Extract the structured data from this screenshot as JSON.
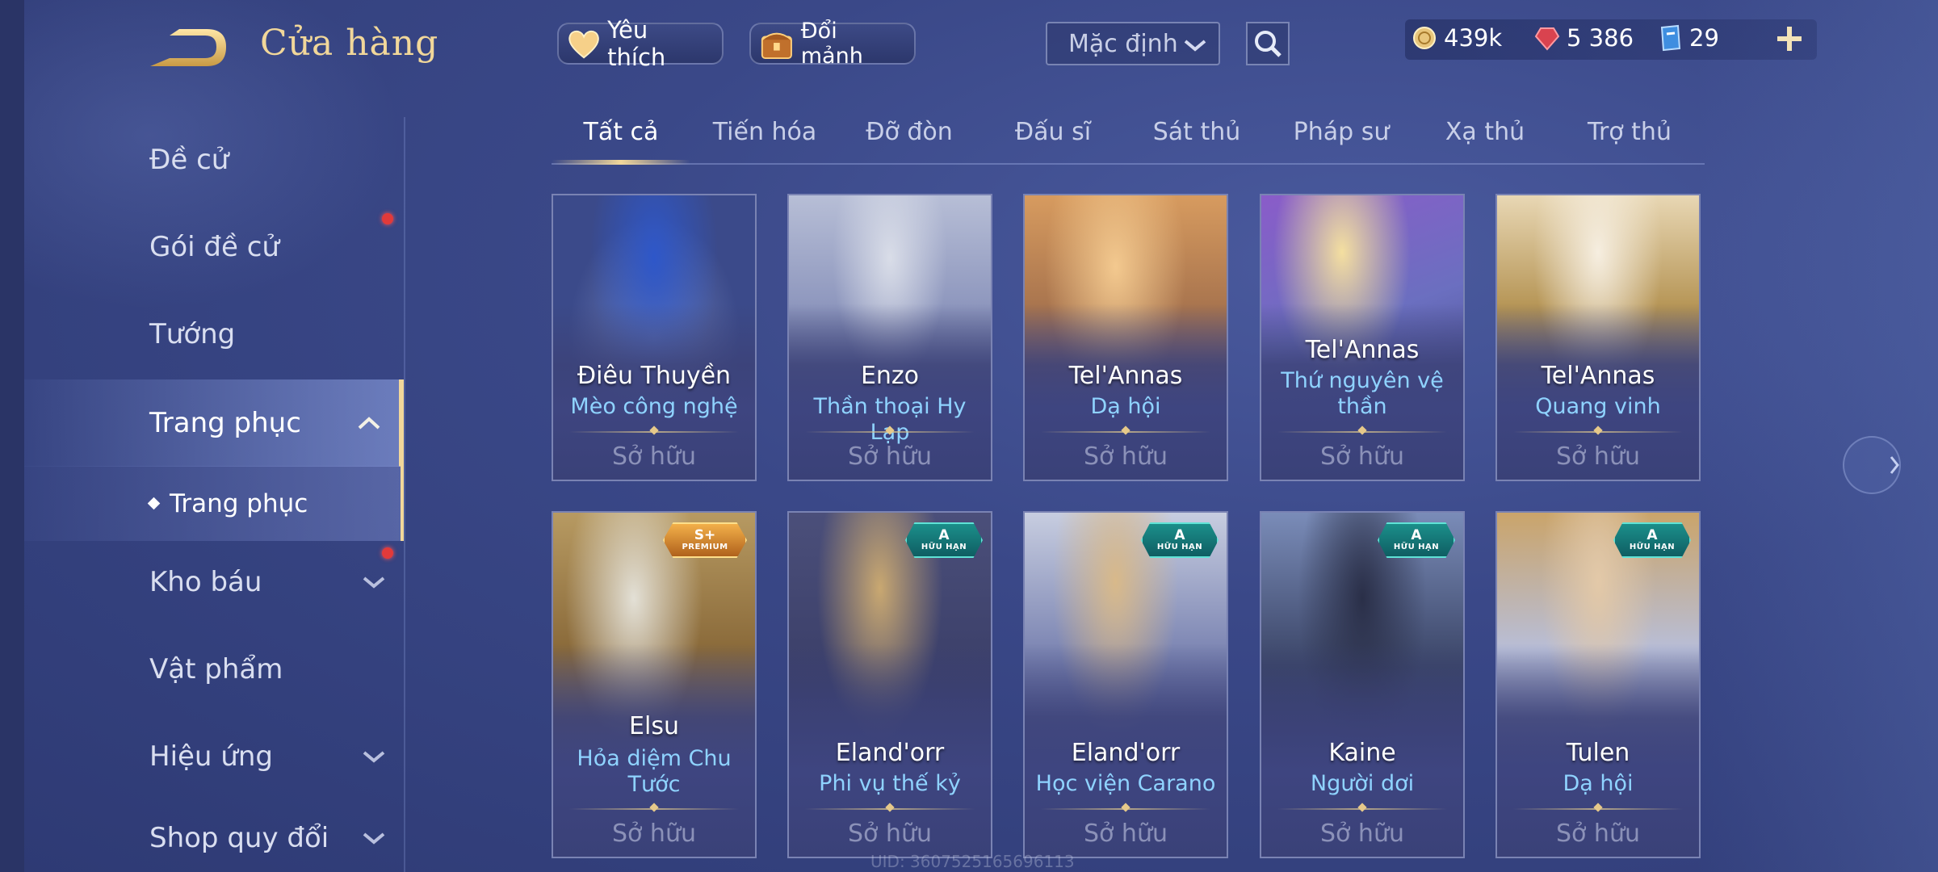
{
  "header": {
    "title": "Cửa hàng",
    "back_icon": "back-arrow-icon"
  },
  "sidebar": {
    "items": [
      {
        "label": "Đề cử"
      },
      {
        "label": "Gói đề cử",
        "notification": true
      },
      {
        "label": "Tướng"
      },
      {
        "label": "Trang phục",
        "expanded": true,
        "active": true
      },
      {
        "label": "Kho báu",
        "notification": true
      },
      {
        "label": "Vật phẩm"
      },
      {
        "label": "Hiệu ứng"
      },
      {
        "label": "Shop quy đổi"
      }
    ],
    "sub_item": {
      "label": "Trang phục",
      "active": true
    }
  },
  "topbar": {
    "favorite_label": "Yêu thích",
    "exchange_label": "Đổi mảnh",
    "sort_value": "Mặc định",
    "currencies": [
      {
        "icon": "gold-coin-icon",
        "value": "439k"
      },
      {
        "icon": "red-gem-icon",
        "value": "5 386"
      },
      {
        "icon": "blue-voucher-icon",
        "value": "29"
      }
    ]
  },
  "tabs": [
    {
      "label": "Tất cả",
      "active": true
    },
    {
      "label": "Tiến hóa"
    },
    {
      "label": "Đỡ đòn"
    },
    {
      "label": "Đấu sĩ"
    },
    {
      "label": "Sát thủ"
    },
    {
      "label": "Pháp sư"
    },
    {
      "label": "Xạ thủ"
    },
    {
      "label": "Trợ thủ"
    }
  ],
  "cards": [
    {
      "hero": "Điêu Thuyền",
      "skin": "Mèo công nghệ",
      "status": "Sở hữu"
    },
    {
      "hero": "Enzo",
      "skin": "Thần thoại Hy Lạp",
      "status": "Sở hữu"
    },
    {
      "hero": "Tel'Annas",
      "skin": "Dạ hội",
      "status": "Sở hữu"
    },
    {
      "hero": "Tel'Annas",
      "skin": "Thứ nguyên vệ thần",
      "status": "Sở hữu"
    },
    {
      "hero": "Tel'Annas",
      "skin": "Quang vinh",
      "status": "Sở hữu"
    },
    {
      "hero": "Elsu",
      "skin": "Hỏa diệm Chu Tước",
      "status": "Sở hữu",
      "badge": {
        "tier": "S+",
        "label": "PREMIUM"
      }
    },
    {
      "hero": "Eland'orr",
      "skin": "Phi vụ thế kỷ",
      "status": "Sở hữu",
      "badge": {
        "tier": "A",
        "label": "HỮU HẠN"
      }
    },
    {
      "hero": "Eland'orr",
      "skin": "Học viện Carano",
      "status": "Sở hữu",
      "badge": {
        "tier": "A",
        "label": "HỮU HẠN"
      }
    },
    {
      "hero": "Kaine",
      "skin": "Người dơi",
      "status": "Sở hữu",
      "badge": {
        "tier": "A",
        "label": "HỮU HẠN"
      }
    },
    {
      "hero": "Tulen",
      "skin": "Dạ hội",
      "status": "Sở hữu",
      "badge": {
        "tier": "A",
        "label": "HỮU HẠN"
      }
    }
  ],
  "footer": {
    "uid": "UID: 3607525165696113"
  },
  "colors": {
    "accent_gold": "#f1d79a",
    "skin_blue": "#8fd3ff",
    "notify_red": "#e23a3a",
    "limited_teal": "#1b8f8a"
  }
}
